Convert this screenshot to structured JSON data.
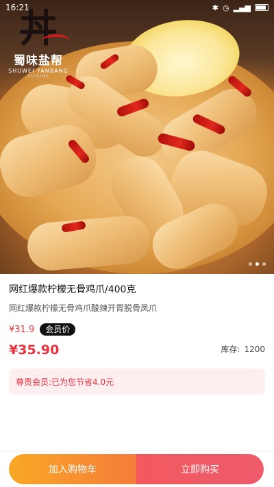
{
  "status_bar": {
    "time": "16:21"
  },
  "hero": {
    "logo": {
      "mark": "丼",
      "name_cn": "蜀味盐帮",
      "name_en": "SHUWEI YANBANG",
      "sub": "CUISINE"
    },
    "carousel": {
      "total": 3,
      "active": 2
    }
  },
  "product": {
    "title": "网红爆款柠檬无骨鸡爪/400克",
    "subtitle": "网红爆款柠檬无骨鸡爪酸辣开胃脱骨凤爪",
    "member_price": "¥31.9",
    "member_badge": "会员价",
    "price": "¥35.90",
    "stock_label": "库存:",
    "stock_value": "1200"
  },
  "savings_text": "尊贵会员:已为您节省4.0元",
  "actions": {
    "add_to_cart": "加入购物车",
    "buy_now": "立即购买"
  },
  "colors": {
    "accent_red": "#e8323e",
    "cart_orange": "#f9a825",
    "buy_red": "#ef5b6b"
  }
}
